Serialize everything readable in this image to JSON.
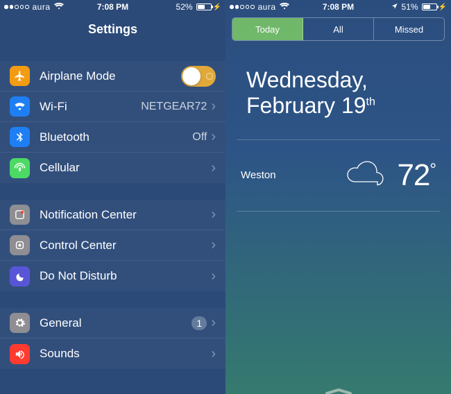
{
  "left": {
    "status": {
      "carrier": "aura",
      "time": "7:08 PM",
      "battery_pct": "52%",
      "signal_filled": 2
    },
    "title": "Settings",
    "sections": [
      [
        {
          "key": "airplane",
          "label": "Airplane Mode",
          "toggle": true
        },
        {
          "key": "wifi",
          "label": "Wi-Fi",
          "value": "NETGEAR72"
        },
        {
          "key": "bt",
          "label": "Bluetooth",
          "value": "Off"
        },
        {
          "key": "cell",
          "label": "Cellular"
        }
      ],
      [
        {
          "key": "nc",
          "label": "Notification Center"
        },
        {
          "key": "cc",
          "label": "Control Center"
        },
        {
          "key": "dnd",
          "label": "Do Not Disturb"
        }
      ],
      [
        {
          "key": "gen",
          "label": "General",
          "badge": "1"
        },
        {
          "key": "snd",
          "label": "Sounds"
        }
      ]
    ]
  },
  "right": {
    "status": {
      "carrier": "aura",
      "time": "7:08 PM",
      "battery_pct": "51%",
      "signal_filled": 2,
      "location": true
    },
    "tabs": [
      "Today",
      "All",
      "Missed"
    ],
    "active_tab": 0,
    "date": {
      "weekday": "Wednesday,",
      "month_day": "February 19",
      "ordinal": "th"
    },
    "weather": {
      "city": "Weston",
      "temp": "72",
      "unit": "°",
      "condition": "cloudy"
    }
  }
}
